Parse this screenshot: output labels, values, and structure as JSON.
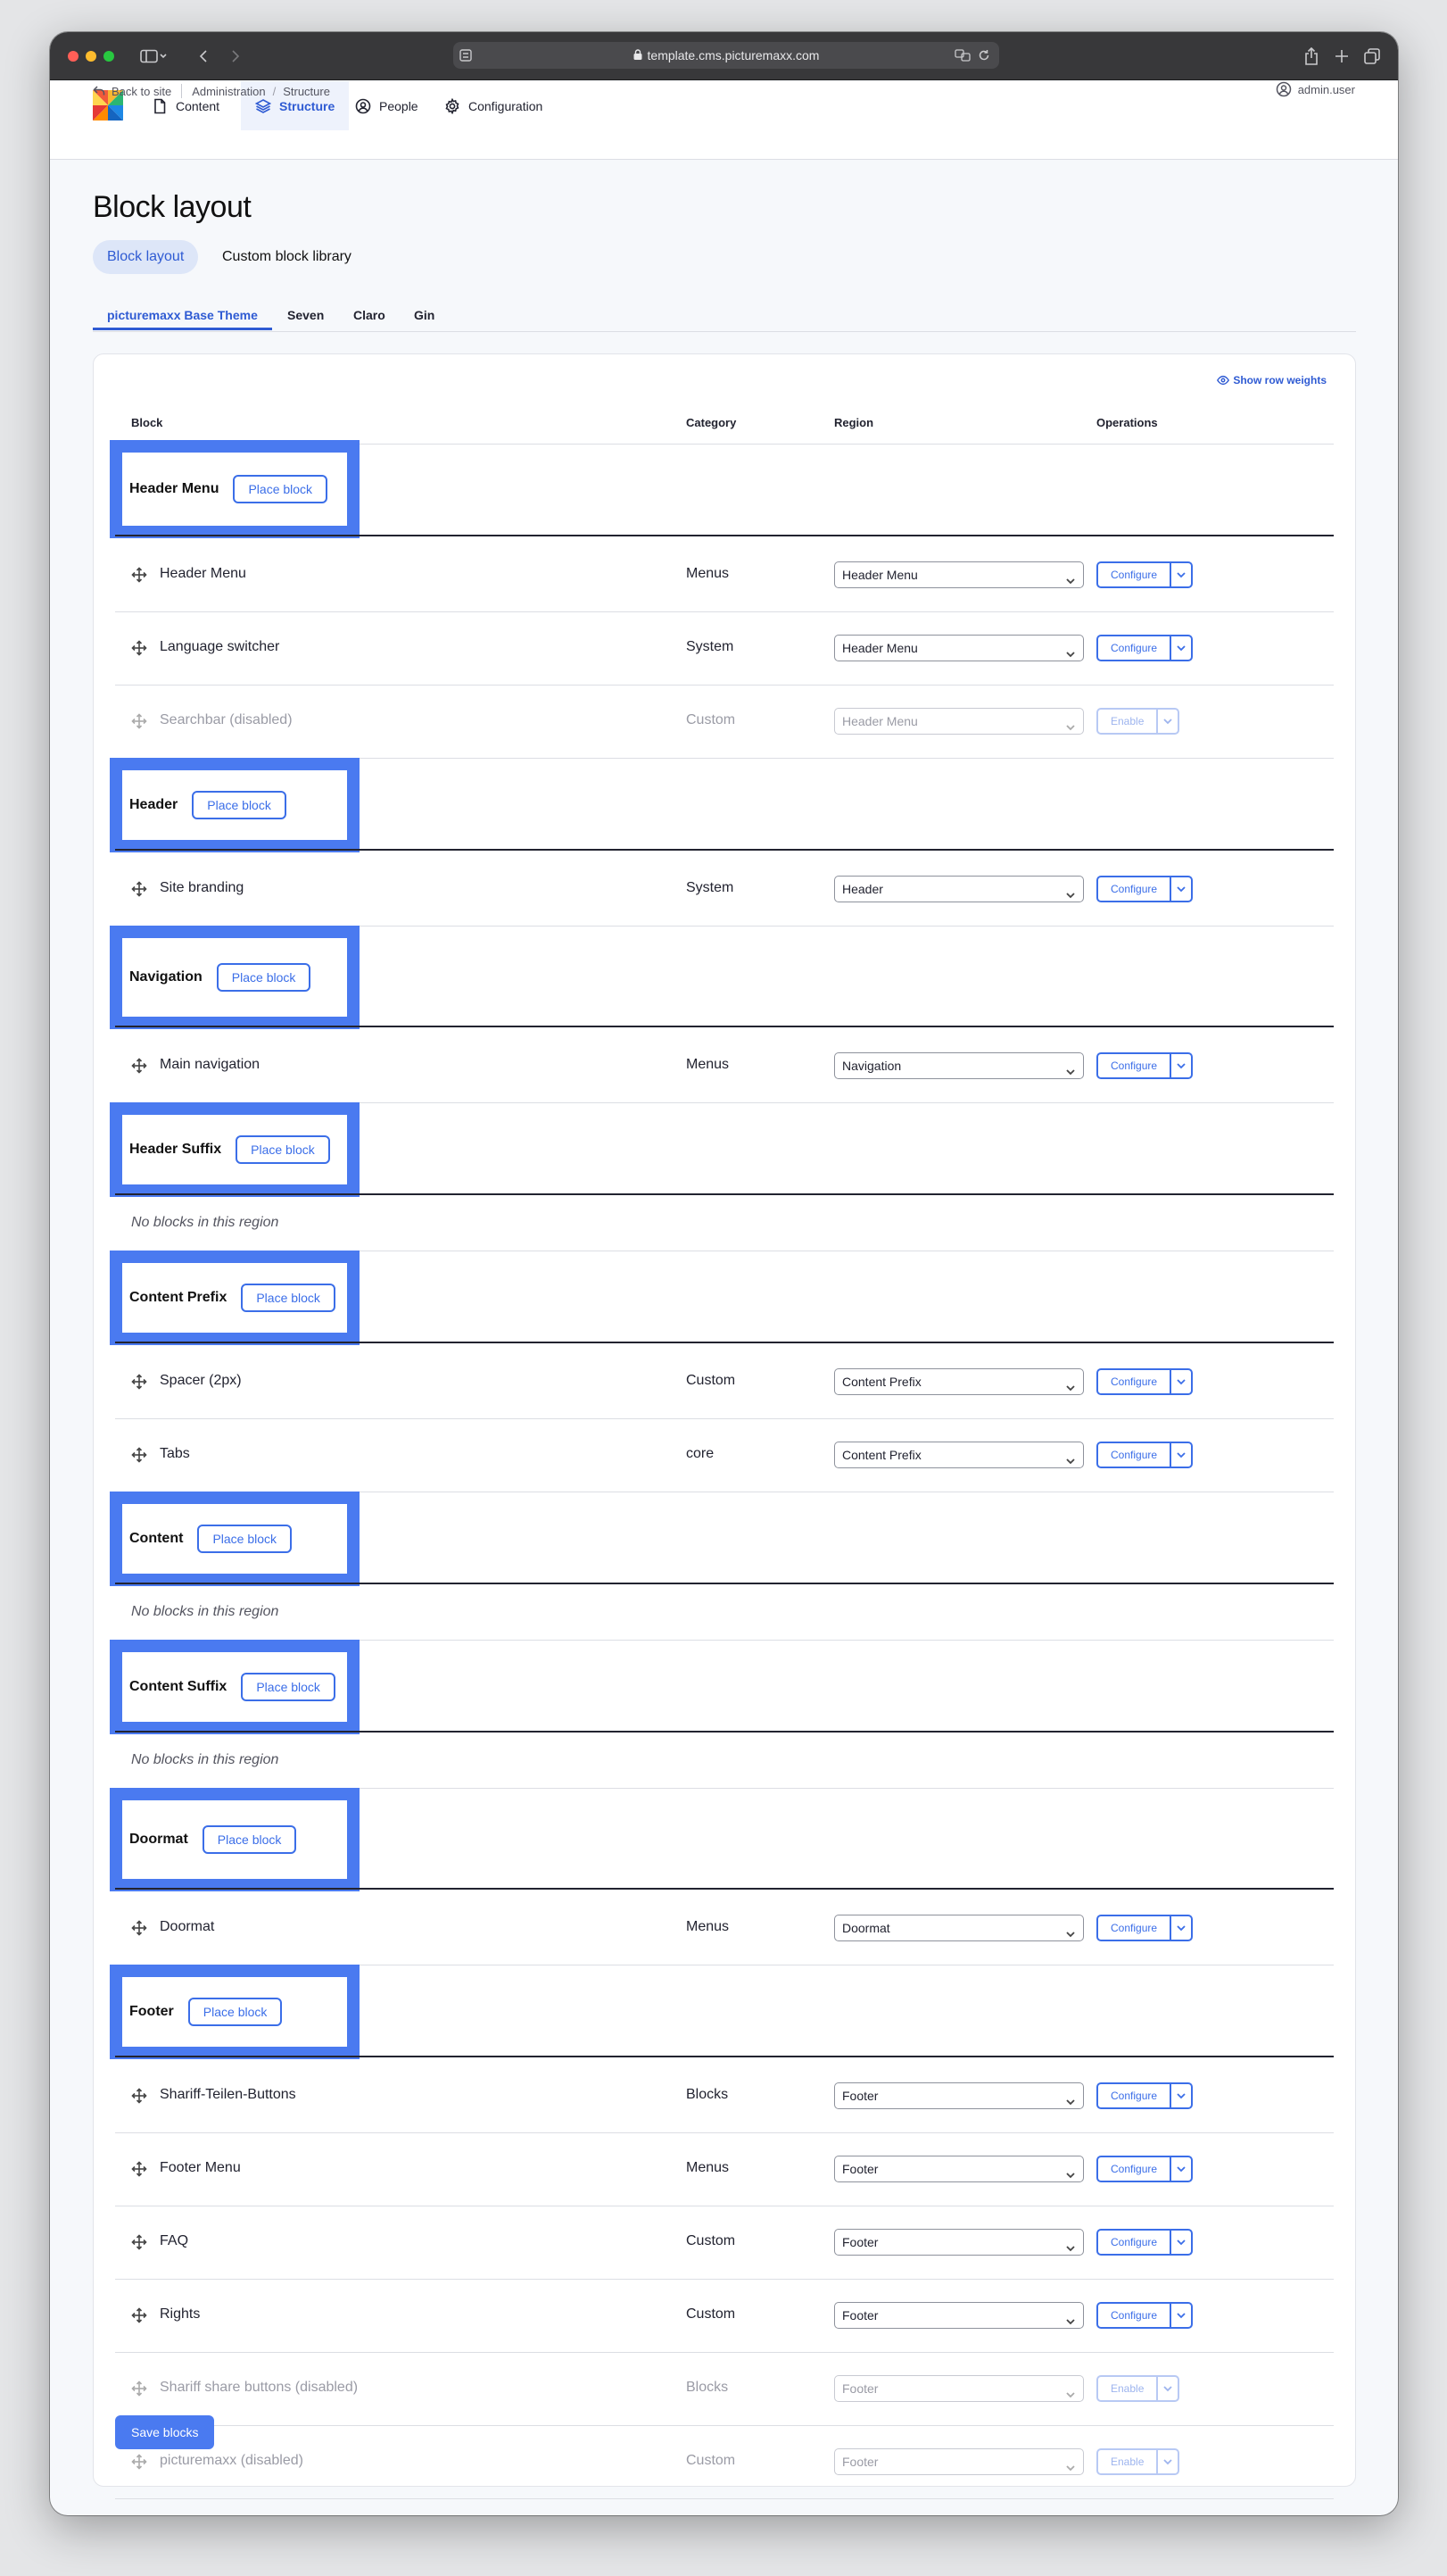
{
  "browser": {
    "url": "template.cms.picturemaxx.com"
  },
  "topnav": {
    "items": [
      {
        "label": "Content"
      },
      {
        "label": "Structure"
      },
      {
        "label": "People"
      },
      {
        "label": "Configuration"
      }
    ]
  },
  "breadcrumb": {
    "back": "Back to site",
    "items": [
      "Administration",
      "Structure"
    ]
  },
  "user": {
    "name": "admin.user"
  },
  "page": {
    "title": "Block layout"
  },
  "subtabs": [
    {
      "label": "Block layout"
    },
    {
      "label": "Custom block library"
    }
  ],
  "themes": [
    {
      "label": "picturemaxx Base Theme"
    },
    {
      "label": "Seven"
    },
    {
      "label": "Claro"
    },
    {
      "label": "Gin"
    }
  ],
  "table": {
    "show_weights": "Show row weights",
    "headers": {
      "block": "Block",
      "category": "Category",
      "region": "Region",
      "operations": "Operations"
    },
    "place_block": "Place block",
    "empty_text": "No blocks in this region",
    "regions": [
      {
        "name": "Header Menu",
        "blocks": [
          {
            "name": "Header Menu",
            "category": "Menus",
            "region": "Header Menu",
            "op": "Configure",
            "disabled": false
          },
          {
            "name": "Language switcher",
            "category": "System",
            "region": "Header Menu",
            "op": "Configure",
            "disabled": false
          },
          {
            "name": "Searchbar (disabled)",
            "category": "Custom",
            "region": "Header Menu",
            "op": "Enable",
            "disabled": true
          }
        ]
      },
      {
        "name": "Header",
        "blocks": [
          {
            "name": "Site branding",
            "category": "System",
            "region": "Header",
            "op": "Configure",
            "disabled": false
          }
        ]
      },
      {
        "name": "Navigation",
        "blocks": [
          {
            "name": "Main navigation",
            "category": "Menus",
            "region": "Navigation",
            "op": "Configure",
            "disabled": false
          }
        ]
      },
      {
        "name": "Header Suffix",
        "blocks": []
      },
      {
        "name": "Content Prefix",
        "blocks": [
          {
            "name": "Spacer (2px)",
            "category": "Custom",
            "region": "Content Prefix",
            "op": "Configure",
            "disabled": false
          },
          {
            "name": "Tabs",
            "category": "core",
            "region": "Content Prefix",
            "op": "Configure",
            "disabled": false
          }
        ]
      },
      {
        "name": "Content",
        "blocks": []
      },
      {
        "name": "Content Suffix",
        "blocks": []
      },
      {
        "name": "Doormat",
        "blocks": [
          {
            "name": "Doormat",
            "category": "Menus",
            "region": "Doormat",
            "op": "Configure",
            "disabled": false
          }
        ]
      },
      {
        "name": "Footer",
        "blocks": [
          {
            "name": "Shariff-Teilen-Buttons",
            "category": "Blocks",
            "region": "Footer",
            "op": "Configure",
            "disabled": false
          },
          {
            "name": "Footer Menu",
            "category": "Menus",
            "region": "Footer",
            "op": "Configure",
            "disabled": false
          },
          {
            "name": "FAQ",
            "category": "Custom",
            "region": "Footer",
            "op": "Configure",
            "disabled": false
          },
          {
            "name": "Rights",
            "category": "Custom",
            "region": "Footer",
            "op": "Configure",
            "disabled": false
          },
          {
            "name": "Shariff share buttons (disabled)",
            "category": "Blocks",
            "region": "Footer",
            "op": "Enable",
            "disabled": true
          },
          {
            "name": "picturemaxx (disabled)",
            "category": "Custom",
            "region": "Footer",
            "op": "Enable",
            "disabled": true
          }
        ]
      }
    ]
  },
  "save_label": "Save blocks"
}
